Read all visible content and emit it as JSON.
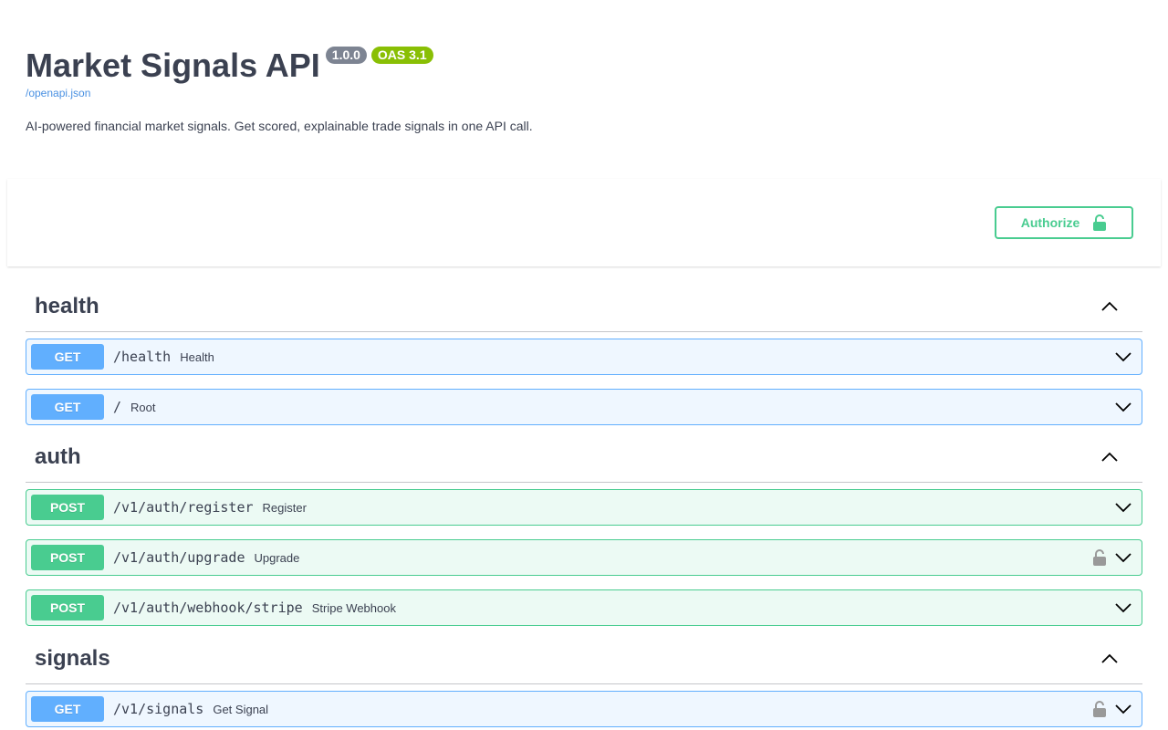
{
  "info": {
    "title": "Market Signals API",
    "version": "1.0.0",
    "oas": "OAS 3.1",
    "spec_link": "/openapi.json",
    "description": "AI-powered financial market signals. Get scored, explainable trade signals in one API call."
  },
  "scheme": {
    "authorize_label": "Authorize",
    "authorize_icon": "unlocked-padlock-icon"
  },
  "colors": {
    "get": "#61affe",
    "post": "#49cc90",
    "oas_badge": "#89bf04",
    "version_badge": "#7d8492",
    "link": "#4990e2"
  },
  "tags": [
    {
      "name": "health",
      "expanded": true,
      "operations": [
        {
          "method": "GET",
          "path": "/health",
          "summary": "Health",
          "locked": false
        },
        {
          "method": "GET",
          "path": "/",
          "summary": "Root",
          "locked": false
        }
      ]
    },
    {
      "name": "auth",
      "expanded": true,
      "operations": [
        {
          "method": "POST",
          "path": "/v1/auth/register",
          "summary": "Register",
          "locked": false
        },
        {
          "method": "POST",
          "path": "/v1/auth/upgrade",
          "summary": "Upgrade",
          "locked": true
        },
        {
          "method": "POST",
          "path": "/v1/auth/webhook/stripe",
          "summary": "Stripe Webhook",
          "locked": false
        }
      ]
    },
    {
      "name": "signals",
      "expanded": true,
      "operations": [
        {
          "method": "GET",
          "path": "/v1/signals",
          "summary": "Get Signal",
          "locked": true
        }
      ]
    }
  ]
}
